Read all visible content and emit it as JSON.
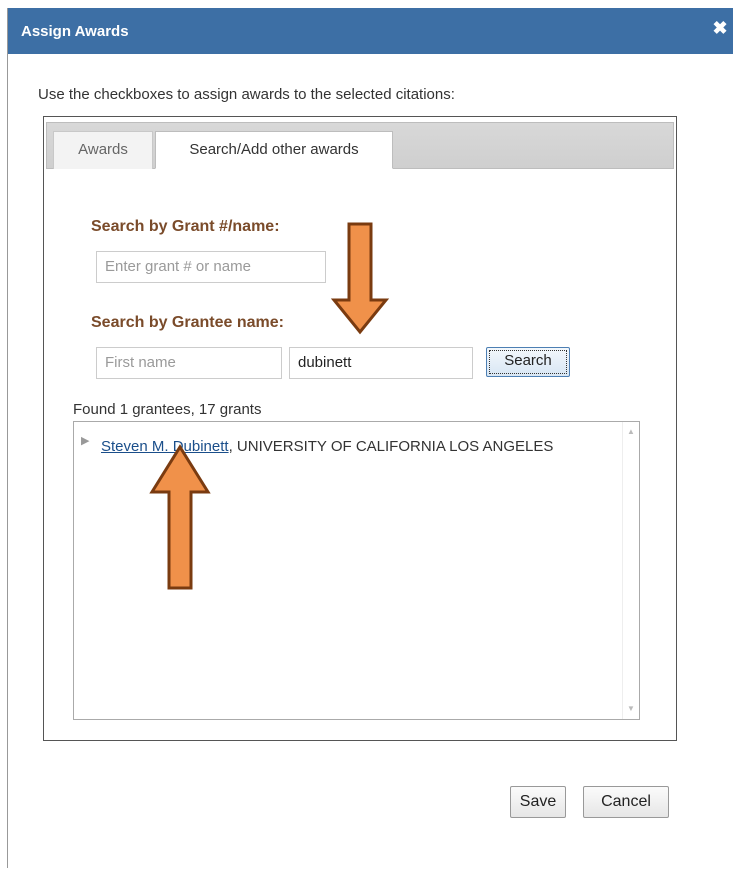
{
  "dialog": {
    "title": "Assign Awards",
    "close_icon": "close-icon"
  },
  "instructions": "Use the checkboxes to assign awards to the selected citations:",
  "tabs": [
    {
      "label": "Awards",
      "active": false
    },
    {
      "label": "Search/Add other awards",
      "active": true
    }
  ],
  "grant_search": {
    "label": "Search by Grant #/name:",
    "placeholder": "Enter grant # or name",
    "value": ""
  },
  "grantee_search": {
    "label": "Search by Grantee name:",
    "first_name_placeholder": "First name",
    "first_name_value": "",
    "last_name_value": "dubinett",
    "search_label": "Search"
  },
  "results": {
    "summary": "Found 1 grantees, 17 grants",
    "items": [
      {
        "name": "Steven M. Dubinett",
        "institution": ", UNIVERSITY OF CALIFORNIA LOS ANGELES",
        "expander_icon": "triangle-right-icon"
      }
    ]
  },
  "footer": {
    "save_label": "Save",
    "cancel_label": "Cancel"
  },
  "colors": {
    "titlebar": "#3d6fa5",
    "section_label": "#7a4b2a",
    "annotation_arrow": "#f0914a",
    "annotation_arrow_border": "#7a3b10"
  }
}
